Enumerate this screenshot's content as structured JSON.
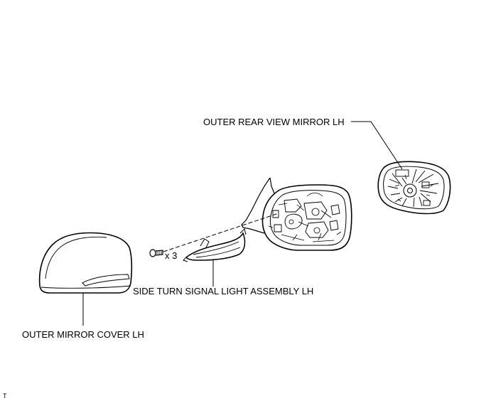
{
  "labels": {
    "outer_rear_view_mirror": "OUTER REAR VIEW MIRROR LH",
    "side_turn_signal_light": "SIDE TURN SIGNAL LIGHT ASSEMBLY LH",
    "outer_mirror_cover": "OUTER MIRROR COVER LH"
  },
  "screw_quantity": "x 3",
  "illustration_code": "T",
  "colors": {
    "line": "#000000",
    "background": "#ffffff"
  }
}
